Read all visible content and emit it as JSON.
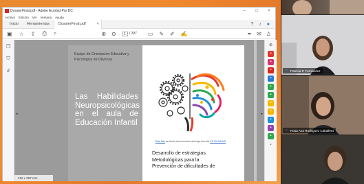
{
  "acrobat": {
    "window_title": "DossierFinal.pdf - Adobe Acrobat Pro DC",
    "menu": [
      "Archivo",
      "Edición",
      "Ver",
      "Ventana",
      "Ayuda"
    ],
    "tabs": {
      "home": "Inicio",
      "tools": "Herramientas",
      "document": "DossierFinal.pdf"
    },
    "page": {
      "current": "1",
      "total": "/ 297"
    },
    "page_size": "210 x 297 mm"
  },
  "pdf": {
    "department": "Equipo de Orientación Educativa y Psicológica de Olivenza",
    "title_lines": [
      "Las Habilidades",
      "Neuropsicológicas",
      "en el aula de",
      "Educación Infantil"
    ],
    "caption_link": "Esta foto",
    "caption_text": " de Autor desconocido está bajo licencia ",
    "caption_license": "CC BY-SA-NC",
    "subtitle_lines": [
      "Desarrollo de estrategias",
      "Metodológicas para la",
      "Prevención de dificultades de"
    ]
  },
  "participants": [
    {
      "name": ""
    },
    {
      "name": "Patricia P. Fernandez"
    },
    {
      "name": "Rosa Ana Rodriguez Caballero"
    },
    {
      "name": ""
    }
  ],
  "colors": {
    "acrobat_red": "#d9271e",
    "share_orange": "#f08a2e",
    "zoom_blue": "#4a8cff"
  }
}
